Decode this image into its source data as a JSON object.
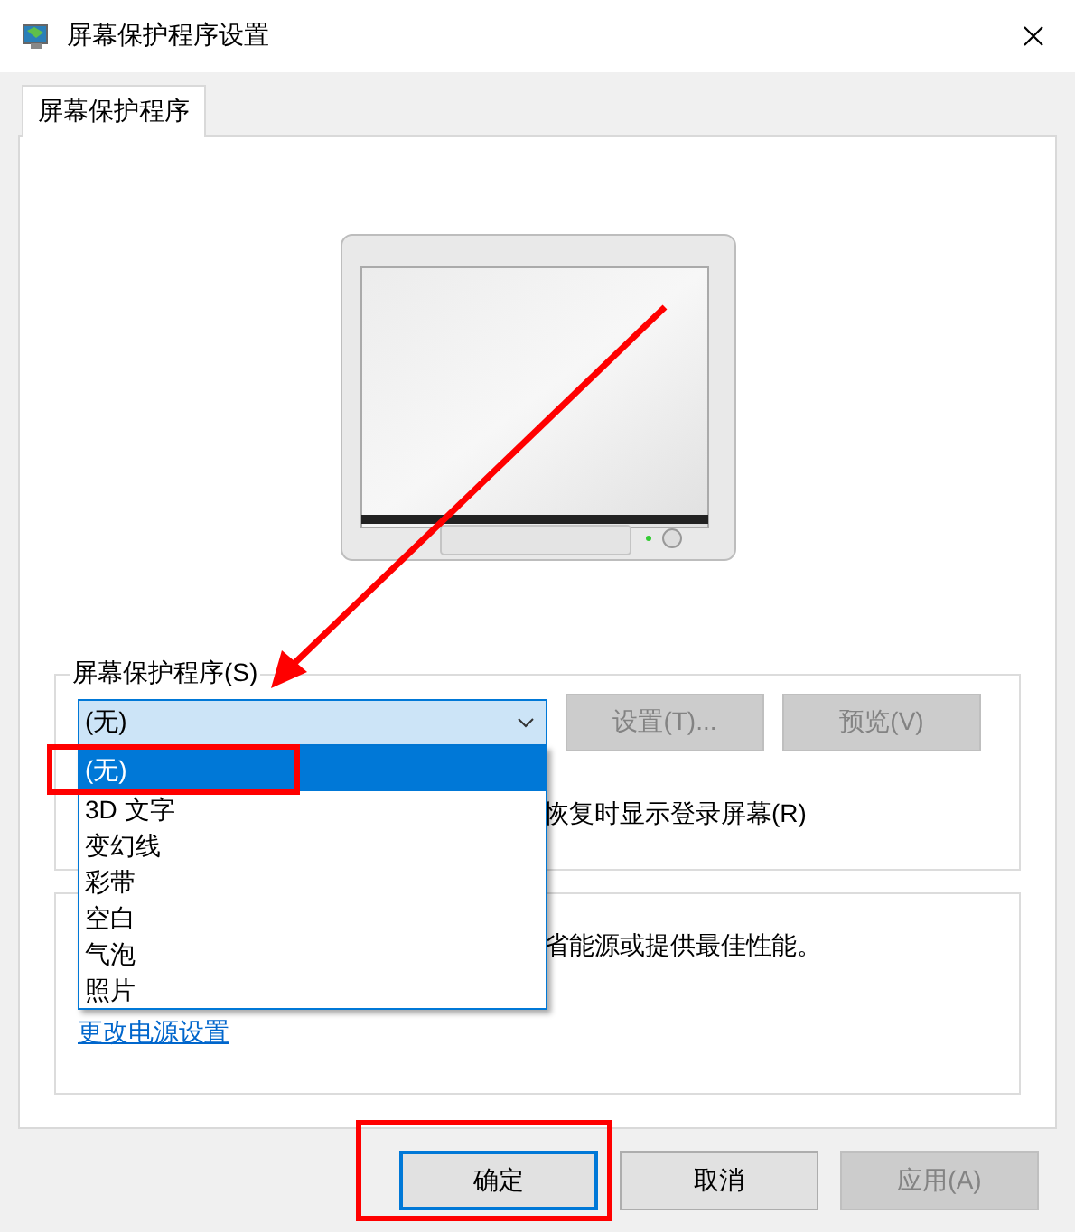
{
  "window": {
    "title": "屏幕保护程序设置"
  },
  "tabs": [
    {
      "label": "屏幕保护程序",
      "selected": true
    }
  ],
  "screensaver": {
    "label": "屏幕保护程序(S)",
    "label_arrow": true,
    "value": "(无)",
    "expanded": true,
    "options": [
      {
        "label": "(无)",
        "selected": true,
        "highlighted": true
      },
      {
        "label": "3D 文字",
        "selected": false,
        "highlighted": false
      },
      {
        "label": "变幻线",
        "selected": false,
        "highlighted": false
      },
      {
        "label": "彩带",
        "selected": false,
        "highlighted": false
      },
      {
        "label": "空白",
        "selected": false,
        "highlighted": false
      },
      {
        "label": "气泡",
        "selected": false,
        "highlighted": false
      },
      {
        "label": "照片",
        "selected": false,
        "highlighted": false
      }
    ],
    "buttons": [
      {
        "label": "设置(T)...",
        "disabled": true
      },
      {
        "label": "预览(V)",
        "disabled": true
      }
    ],
    "logon_text": "恢复时显示登录屏幕(R)"
  },
  "power": {
    "text": "省能源或提供最佳性能。",
    "link": "更改电源设置"
  },
  "buttons": [
    {
      "label": "确定",
      "default": true,
      "disabled": false,
      "highlighted": true
    },
    {
      "label": "取消",
      "default": false,
      "disabled": false,
      "highlighted": false
    },
    {
      "label": "应用(A)",
      "default": false,
      "disabled": true,
      "highlighted": false
    }
  ]
}
